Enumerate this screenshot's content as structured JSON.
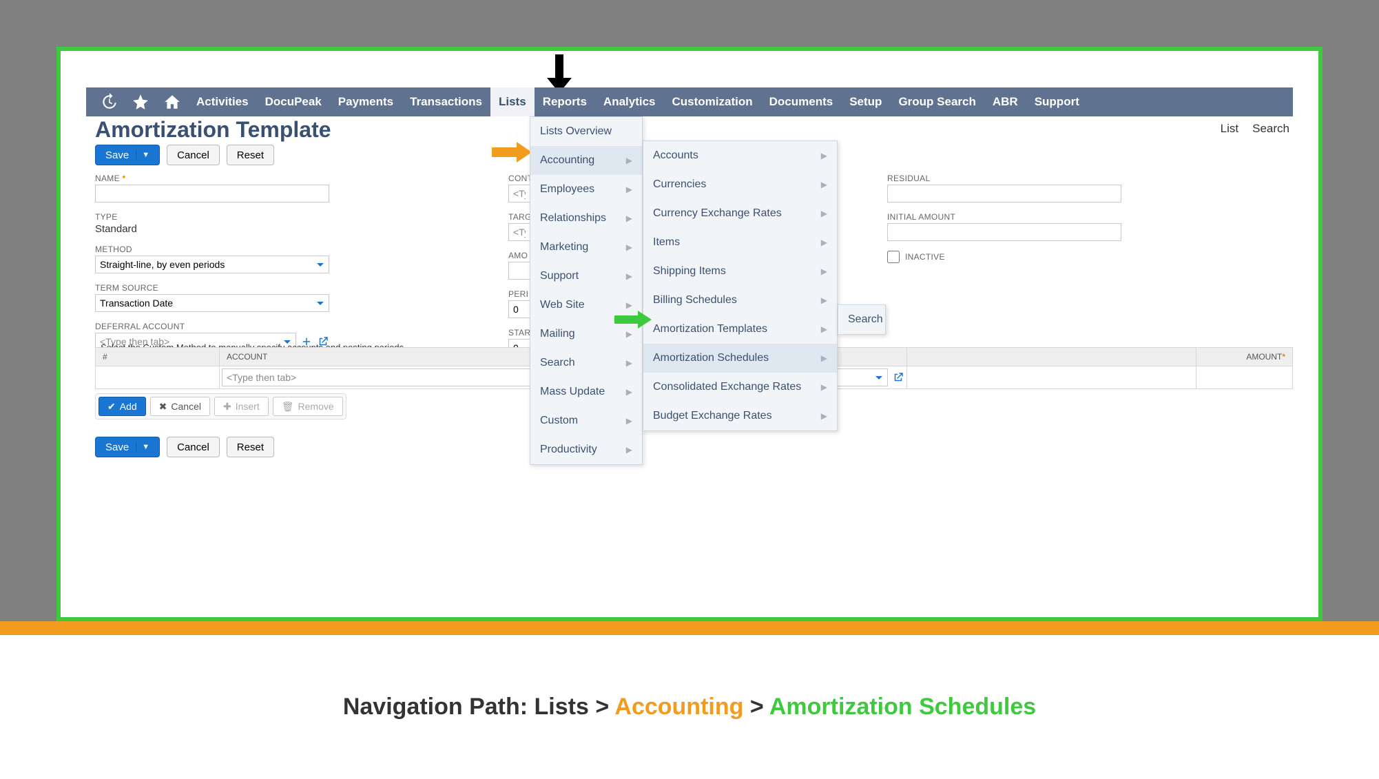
{
  "nav": {
    "items": [
      "Activities",
      "DocuPeak",
      "Payments",
      "Transactions",
      "Lists",
      "Reports",
      "Analytics",
      "Customization",
      "Documents",
      "Setup",
      "Group Search",
      "ABR",
      "Support"
    ],
    "active_index": 4
  },
  "page": {
    "title": "Amortization Template",
    "links": {
      "list": "List",
      "search": "Search"
    }
  },
  "buttons": {
    "save": "Save",
    "cancel": "Cancel",
    "reset": "Reset",
    "add": "Add",
    "cancel_row": "Cancel",
    "insert": "Insert",
    "remove": "Remove"
  },
  "fields": {
    "name": {
      "label": "NAME",
      "required": true,
      "value": ""
    },
    "type": {
      "label": "TYPE",
      "value": "Standard"
    },
    "method": {
      "label": "METHOD",
      "value": "Straight-line, by even periods"
    },
    "term_source": {
      "label": "TERM SOURCE",
      "value": "Transaction Date"
    },
    "deferral_account": {
      "label": "DEFERRAL ACCOUNT",
      "value": "<Type then tab>"
    },
    "cont": {
      "label": "CONT",
      "value": "<Typ"
    },
    "targ": {
      "label": "TARG",
      "value": "<Typ"
    },
    "amou": {
      "label": "AMO",
      "value": ""
    },
    "peri": {
      "label": "PERI",
      "value": "0"
    },
    "star": {
      "label": "STAR",
      "value": "0"
    },
    "residual": {
      "label": "RESIDUAL",
      "value": ""
    },
    "initial_amount": {
      "label": "INITIAL AMOUNT",
      "value": ""
    },
    "inactive": {
      "label": "INACTIVE"
    }
  },
  "table": {
    "help": "Select the Custom Method to manually specify accounts and posting periods.",
    "cols": {
      "num": "#",
      "account": "ACCOUNT",
      "amount": "AMOUNT"
    },
    "row_placeholder": "<Type then tab>"
  },
  "menu1": {
    "items": [
      {
        "label": "Lists Overview",
        "sub": false
      },
      {
        "label": "Accounting",
        "sub": true,
        "hover": true
      },
      {
        "label": "Employees",
        "sub": true
      },
      {
        "label": "Relationships",
        "sub": true
      },
      {
        "label": "Marketing",
        "sub": true
      },
      {
        "label": "Support",
        "sub": true
      },
      {
        "label": "Web Site",
        "sub": true
      },
      {
        "label": "Mailing",
        "sub": true
      },
      {
        "label": "Search",
        "sub": true
      },
      {
        "label": "Mass Update",
        "sub": true
      },
      {
        "label": "Custom",
        "sub": true
      },
      {
        "label": "Productivity",
        "sub": true
      }
    ]
  },
  "menu2": {
    "items": [
      {
        "label": "Accounts",
        "sub": true
      },
      {
        "label": "Currencies",
        "sub": true
      },
      {
        "label": "Currency Exchange Rates",
        "sub": true
      },
      {
        "label": "Items",
        "sub": true
      },
      {
        "label": "Shipping Items",
        "sub": true
      },
      {
        "label": "Billing Schedules",
        "sub": true
      },
      {
        "label": "Amortization Templates",
        "sub": true
      },
      {
        "label": "Amortization Schedules",
        "sub": true,
        "hover": true
      },
      {
        "label": "Consolidated Exchange Rates",
        "sub": true
      },
      {
        "label": "Budget Exchange Rates",
        "sub": true
      }
    ]
  },
  "menu3": {
    "label": "Search"
  },
  "caption": {
    "prefix": "Navigation Path:  ",
    "p1": "Lists",
    "sep": " > ",
    "p2": "Accounting",
    "p3": "Amortization Schedules"
  }
}
